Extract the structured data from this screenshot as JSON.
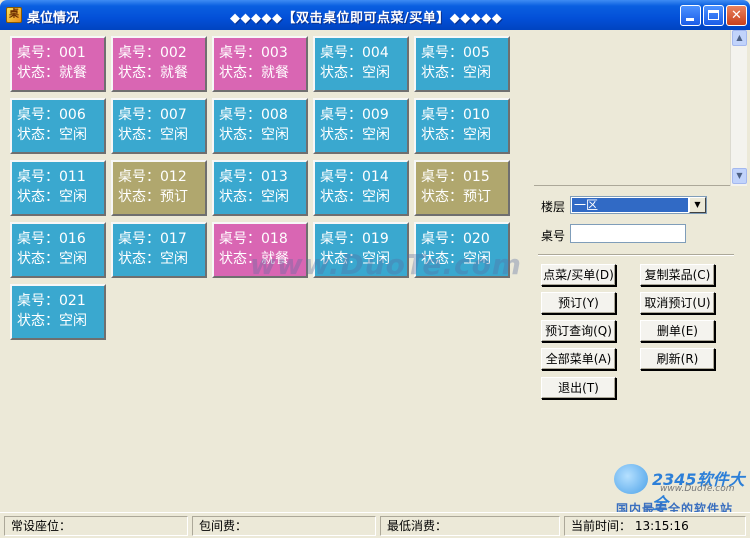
{
  "window": {
    "icon_glyph": "桌",
    "title": "桌位情况",
    "subtitle": "◆◆◆◆◆【双击桌位即可点菜/买单】◆◆◆◆◆",
    "minimize_icon": "minimize-icon",
    "maximize_icon": "maximize-icon",
    "close_icon": "close-icon",
    "close_glyph": "✕"
  },
  "tables": [
    {
      "label": "桌号：001",
      "status": "状态：就餐",
      "color": "#d966b3"
    },
    {
      "label": "桌号：002",
      "status": "状态：就餐",
      "color": "#d966b3"
    },
    {
      "label": "桌号：003",
      "status": "状态：就餐",
      "color": "#d966b3"
    },
    {
      "label": "桌号：004",
      "status": "状态：空闲",
      "color": "#3aa8cf"
    },
    {
      "label": "桌号：005",
      "status": "状态：空闲",
      "color": "#3aa8cf"
    },
    {
      "label": "桌号：006",
      "status": "状态：空闲",
      "color": "#3aa8cf"
    },
    {
      "label": "桌号：007",
      "status": "状态：空闲",
      "color": "#3aa8cf"
    },
    {
      "label": "桌号：008",
      "status": "状态：空闲",
      "color": "#3aa8cf"
    },
    {
      "label": "桌号：009",
      "status": "状态：空闲",
      "color": "#3aa8cf"
    },
    {
      "label": "桌号：010",
      "status": "状态：空闲",
      "color": "#3aa8cf"
    },
    {
      "label": "桌号：011",
      "status": "状态：空闲",
      "color": "#3aa8cf"
    },
    {
      "label": "桌号：012",
      "status": "状态：预订",
      "color": "#b0a76e"
    },
    {
      "label": "桌号：013",
      "status": "状态：空闲",
      "color": "#3aa8cf"
    },
    {
      "label": "桌号：014",
      "status": "状态：空闲",
      "color": "#3aa8cf"
    },
    {
      "label": "桌号：015",
      "status": "状态：预订",
      "color": "#b0a76e"
    },
    {
      "label": "桌号：016",
      "status": "状态：空闲",
      "color": "#3aa8cf"
    },
    {
      "label": "桌号：017",
      "status": "状态：空闲",
      "color": "#3aa8cf"
    },
    {
      "label": "桌号：018",
      "status": "状态：就餐",
      "color": "#d966b3"
    },
    {
      "label": "桌号：019",
      "status": "状态：空闲",
      "color": "#3aa8cf"
    },
    {
      "label": "桌号：020",
      "status": "状态：空闲",
      "color": "#3aa8cf"
    },
    {
      "label": "桌号：021",
      "status": "状态：空闲",
      "color": "#3aa8cf"
    }
  ],
  "side": {
    "floor_label": "楼层",
    "floor_value": "一区",
    "table_label": "桌号",
    "table_value": "",
    "buttons": {
      "order": "点菜/买单(D)",
      "copy_dish": "复制菜品(C)",
      "reserve": "预订(Y)",
      "cancel_reserve": "取消预订(U)",
      "reserve_query": "预订查询(Q)",
      "delete_order": "删单(E)",
      "all_orders": "全部菜单(A)",
      "refresh": "刷新(R)",
      "exit": "退出(T)"
    }
  },
  "watermark": {
    "site": "www.DuoTe.com",
    "brand": "2345软件大全",
    "brand_url": "www.DuoTe.com",
    "slogan": "国内最安全的软件站"
  },
  "statusbar": {
    "regular_seats": "常设座位：",
    "room_fee": "包间费：",
    "min_spend": "最低消费：",
    "current_time": "当前时间：  13:15:16"
  }
}
